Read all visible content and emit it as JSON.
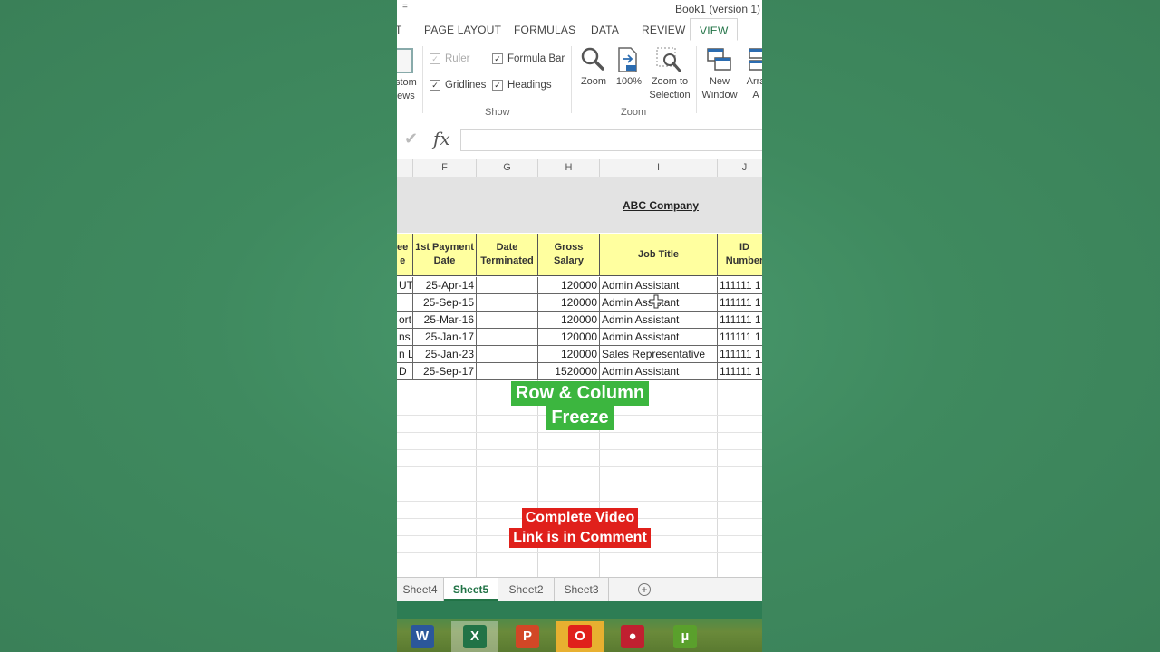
{
  "window": {
    "title": "Book1 (version 1)",
    "quick_access": "="
  },
  "tabs": [
    "T",
    "PAGE LAYOUT",
    "FORMULAS",
    "DATA",
    "REVIEW",
    "VIEW"
  ],
  "ribbon": {
    "custom_views_partial": [
      "stom",
      "ews"
    ],
    "show": {
      "ruler": "Ruler",
      "formula_bar": "Formula Bar",
      "gridlines": "Gridlines",
      "headings": "Headings",
      "group_label": "Show"
    },
    "zoom": {
      "zoom": "Zoom",
      "zoom100": "100%",
      "zoom_selection_1": "Zoom to",
      "zoom_selection_2": "Selection",
      "group_label": "Zoom"
    },
    "window": {
      "new_window_1": "New",
      "new_window_2": "Window",
      "arrange_1": "Arra",
      "arrange_2": "A"
    }
  },
  "formula_bar": {
    "fx": "fx",
    "value": ""
  },
  "columns": [
    "F",
    "G",
    "H",
    "I",
    "J"
  ],
  "sheet": {
    "company": "ABC Company",
    "headers": {
      "partial": [
        "ee",
        "e"
      ],
      "f": [
        "1st Payment",
        "Date"
      ],
      "g": [
        "Date",
        "Terminated"
      ],
      "h": "Gross Salary",
      "i": "Job Title",
      "j": [
        "ID",
        "Number"
      ]
    },
    "rows": [
      {
        "e": "UT",
        "f": "25-Apr-14",
        "g": "",
        "h": "120000",
        "i": "Admin Assistant",
        "j": "111111 1"
      },
      {
        "e": "",
        "f": "25-Sep-15",
        "g": "",
        "h": "120000",
        "i": "Admin Assistant",
        "j": "111111 1"
      },
      {
        "e": "ort (",
        "f": "25-Mar-16",
        "g": "",
        "h": "120000",
        "i": "Admin Assistant",
        "j": "111111 1"
      },
      {
        "e": "ns \\",
        "f": "25-Jan-17",
        "g": "",
        "h": "120000",
        "i": "Admin Assistant",
        "j": "111111 1"
      },
      {
        "e": "n L",
        "f": "25-Jan-23",
        "g": "",
        "h": "120000",
        "i": "Sales Representative",
        "j": "111111 1"
      },
      {
        "e": "D",
        "f": "25-Sep-17",
        "g": "",
        "h": "1520000",
        "i": "Admin Assistant",
        "j": "111111 1"
      }
    ]
  },
  "overlay": {
    "line1": "Row & Column",
    "line2": "Freeze",
    "cta1": "Complete Video",
    "cta2": "Link is in Comment"
  },
  "sheet_tabs": [
    "Sheet4",
    "Sheet5",
    "Sheet2",
    "Sheet3"
  ],
  "active_sheet": "Sheet5",
  "add_sheet": "+",
  "taskbar_apps": [
    {
      "name": "word-icon",
      "glyph": "W",
      "color": "#2b579a"
    },
    {
      "name": "excel-icon",
      "glyph": "X",
      "color": "#217346"
    },
    {
      "name": "powerpoint-icon",
      "glyph": "P",
      "color": "#d24726"
    },
    {
      "name": "opera-icon",
      "glyph": "O",
      "color": "#e0201b"
    },
    {
      "name": "screen-recorder-icon",
      "glyph": "●",
      "color": "#c02030"
    },
    {
      "name": "utorrent-icon",
      "glyph": "µ",
      "color": "#5aa02c"
    }
  ]
}
